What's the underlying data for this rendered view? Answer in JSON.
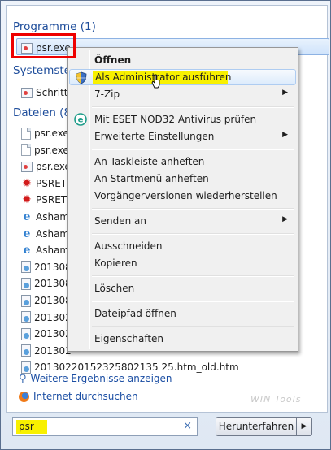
{
  "sections": {
    "programs_header": "Programme (1)",
    "system_header": "Systemste",
    "files_header": "Dateien (8"
  },
  "programs": [
    {
      "label": "psr.exe",
      "icon": "exe-icon"
    }
  ],
  "system_items": [
    {
      "label": "Schritt",
      "icon": "steps-recorder-icon"
    }
  ],
  "files": [
    {
      "label": "psr.exe",
      "icon": "document-icon"
    },
    {
      "label": "psr.exe",
      "icon": "document-icon"
    },
    {
      "label": "psr.exe",
      "icon": "exe-icon"
    },
    {
      "label": "PSRET",
      "icon": "red-splat-icon"
    },
    {
      "label": "PSRET",
      "icon": "red-splat-icon"
    },
    {
      "label": "Asham",
      "icon": "ie-icon"
    },
    {
      "label": "Asham",
      "icon": "ie-icon"
    },
    {
      "label": "Asham",
      "icon": "ie-icon"
    },
    {
      "label": "201308",
      "icon": "web-icon"
    },
    {
      "label": "201308",
      "icon": "web-icon"
    },
    {
      "label": "201308",
      "icon": "web-icon"
    },
    {
      "label": "201302",
      "icon": "web-icon"
    },
    {
      "label": "201302",
      "icon": "web-icon"
    },
    {
      "label": "201302",
      "icon": "web-icon"
    },
    {
      "label": "20130220152325802135 25.htm_old.htm",
      "icon": "web-icon"
    }
  ],
  "context_menu": [
    {
      "label": "Öffnen",
      "bold": true
    },
    {
      "label": "Als Administrator ausführen",
      "icon": "uac-shield-icon",
      "highlighted": true
    },
    {
      "label": "7-Zip",
      "submenu": true
    },
    {
      "sep": true
    },
    {
      "label": "Mit ESET NOD32 Antivirus prüfen",
      "icon": "eset-icon"
    },
    {
      "label": "Erweiterte Einstellungen",
      "submenu": true
    },
    {
      "sep": true
    },
    {
      "label": "An Taskleiste anheften"
    },
    {
      "label": "An Startmenü anheften"
    },
    {
      "label": "Vorgängerversionen wiederherstellen"
    },
    {
      "sep": true
    },
    {
      "label": "Senden an",
      "submenu": true
    },
    {
      "sep": true
    },
    {
      "label": "Ausschneiden"
    },
    {
      "label": "Kopieren"
    },
    {
      "sep": true
    },
    {
      "label": "Löschen"
    },
    {
      "sep": true
    },
    {
      "label": "Dateipfad öffnen"
    },
    {
      "sep": true
    },
    {
      "label": "Eigenschaften"
    }
  ],
  "footer": {
    "more_results": "Weitere Ergebnisse anzeigen",
    "search_internet": "Internet durchsuchen"
  },
  "search": {
    "value": "psr",
    "clear_glyph": "×"
  },
  "shutdown": {
    "label": "Herunterfahren",
    "arrow": "▶"
  },
  "watermark": "WIN Tools",
  "colors": {
    "accent_header": "#1e4d9b",
    "highlight_marker": "#f8f000",
    "annotation_red": "#e00000"
  }
}
